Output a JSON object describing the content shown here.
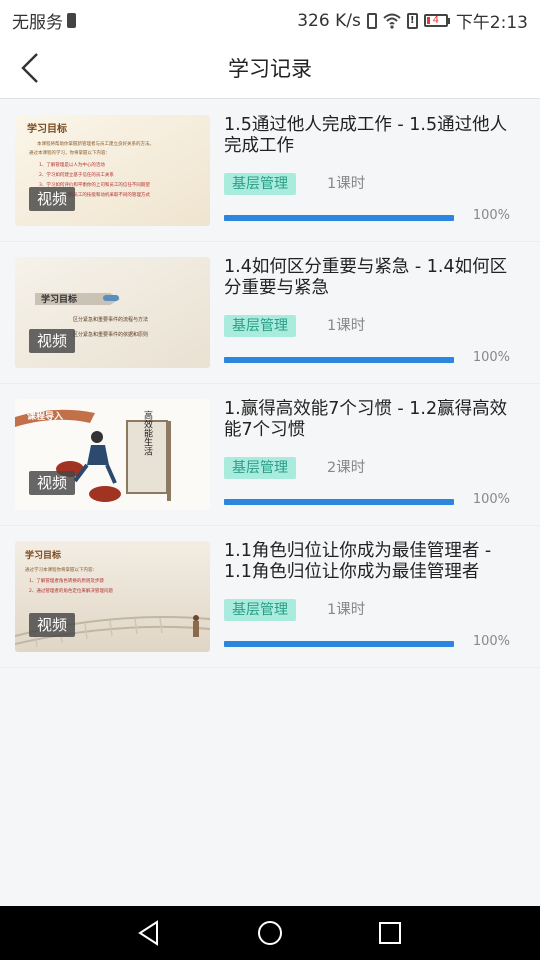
{
  "status": {
    "carrier": "无服务",
    "speed": "326 K/s",
    "battery_level": "4",
    "time": "下午2:13"
  },
  "header": {
    "title": "学习记录"
  },
  "records": [
    {
      "title": "1.5通过他人完成工作 - 1.5通过他人完成工作",
      "badge": "视频",
      "tag": "基层管理",
      "hours": "1课时",
      "progress_label": "100%",
      "progress_value": 100,
      "thumb": {
        "heading": "学习目标",
        "lines": [
          "本课程将帮助你掌握新管理者与员工建立良好关系的方法。",
          "通过本课程的学习，你将掌握以下内容：",
          "1、了解管理是以人为中心的活动",
          "2、学习如何建立基于信任的员工关系",
          "3、学习如何评价和平衡你的上司和员工的信任不同期望",
          "4、学会如何识别员工的技能和动机采取不同的管理方式"
        ]
      }
    },
    {
      "title": "1.4如何区分重要与紧急 - 1.4如何区分重要与紧急",
      "badge": "视频",
      "tag": "基层管理",
      "hours": "1课时",
      "progress_label": "100%",
      "progress_value": 100,
      "thumb": {
        "heading": "学习目标",
        "lines": [
          "区分紧急和重要事件的流程与方法",
          "区分紧急和重要事件的依据和原则"
        ]
      }
    },
    {
      "title": "1.赢得高效能7个习惯 - 1.2赢得高效能7个习惯",
      "badge": "视频",
      "tag": "基层管理",
      "hours": "2课时",
      "progress_label": "100%",
      "progress_value": 100,
      "thumb": {
        "heading": "课程导入",
        "sign": "高效能生活"
      }
    },
    {
      "title": "1.1角色归位让你成为最佳管理者 - 1.1角色归位让你成为最佳管理者",
      "badge": "视频",
      "tag": "基层管理",
      "hours": "1课时",
      "progress_label": "100%",
      "progress_value": 100,
      "thumb": {
        "heading": "学习目标",
        "lines": [
          "通过学习本课程你将掌握以下内容：",
          "1、了解管理者角色转换的原则及步骤",
          "2、通过管理者的角色定位来解决管理问题"
        ]
      }
    }
  ],
  "colors": {
    "accent_blue": "#2b86e0",
    "tag_bg": "#a9ecde",
    "tag_text": "#2a9d86"
  }
}
